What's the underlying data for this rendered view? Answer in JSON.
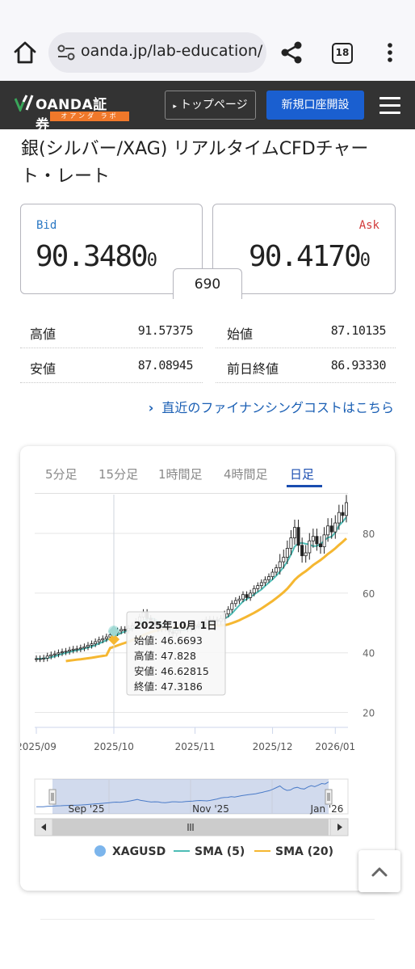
{
  "browser": {
    "url": "oanda.jp/lab-education/",
    "tab_count": "18"
  },
  "header": {
    "logo_text": "OANDA証券",
    "logo_sub": "オアンダ ラボ",
    "top_page_label": "トップページ",
    "open_account_label": "新規口座開設"
  },
  "page": {
    "title": "銀(シルバー/XAG) リアルタイムCFDチャート・レート"
  },
  "prices": {
    "bid_label": "Bid",
    "bid_main": "90.3480",
    "bid_small": "0",
    "ask_label": "Ask",
    "ask_main": "90.4170",
    "ask_small": "0",
    "spread": "690"
  },
  "stats": {
    "high_label": "高値",
    "high_value": "91.57375",
    "open_label": "始値",
    "open_value": "87.10135",
    "low_label": "安値",
    "low_value": "87.08945",
    "prev_close_label": "前日終値",
    "prev_close_value": "86.93330"
  },
  "financing_link": "直近のファイナンシングコストはこちら",
  "chart": {
    "tabs": [
      "5分足",
      "15分足",
      "1時間足",
      "4時間足",
      "日足"
    ],
    "active_tab": "日足",
    "tooltip": {
      "date": "2025年10月 1日",
      "open": "始値: 46.6693",
      "high": "高値: 47.828",
      "low": "安値: 46.62815",
      "close": "終値: 47.3186"
    },
    "navigator_labels": [
      "Sep '25",
      "Nov '25",
      "Jan '26"
    ],
    "legend": [
      {
        "name": "XAGUSD",
        "color": "#7cb5ec"
      },
      {
        "name": "SMA (5)",
        "color": "#4dbdb6"
      },
      {
        "name": "SMA (20)",
        "color": "#f5b731"
      }
    ]
  },
  "chart_data": {
    "type": "candlestick",
    "ylim": [
      15,
      93
    ],
    "yticks": [
      20,
      40,
      60,
      80
    ],
    "x_tick_labels": [
      "2025/09",
      "2025/10",
      "2025/11",
      "2025/12",
      "2026/01"
    ],
    "close_series": [
      38.0,
      38.0,
      38.2,
      38.9,
      39.3,
      39.6,
      40.0,
      40.3,
      40.5,
      40.9,
      41.2,
      41.3,
      41.6,
      42.0,
      42.5,
      43.0,
      43.7,
      44.3,
      44.7,
      45.3,
      46.0,
      46.7,
      47.3,
      47.8,
      47.5,
      48.2,
      49.0,
      50.5,
      52.0,
      53.5,
      51.5,
      50.5,
      49.0,
      48.0,
      48.5,
      48.2,
      47.0,
      46.5,
      47.5,
      48.5,
      48.6,
      48.0,
      48.3,
      49.0,
      49.5,
      50.0,
      51.0,
      51.2,
      51.0,
      50.5,
      51.5,
      53.0,
      54.5,
      56.5,
      57.5,
      58.0,
      59.5,
      58.5,
      60.0,
      61.5,
      62.5,
      63.5,
      64.5,
      65.5,
      67.0,
      68.5,
      70.5,
      72.0,
      75.0,
      78.5,
      82.0,
      76.0,
      72.5,
      73.5,
      77.5,
      79.0,
      76.5,
      75.5,
      79.5,
      82.5,
      80.5,
      83.5,
      87.0,
      86.0,
      90.3
    ],
    "series": [
      {
        "name": "XAGUSD"
      },
      {
        "name": "SMA (5)"
      },
      {
        "name": "SMA (20)"
      }
    ]
  }
}
